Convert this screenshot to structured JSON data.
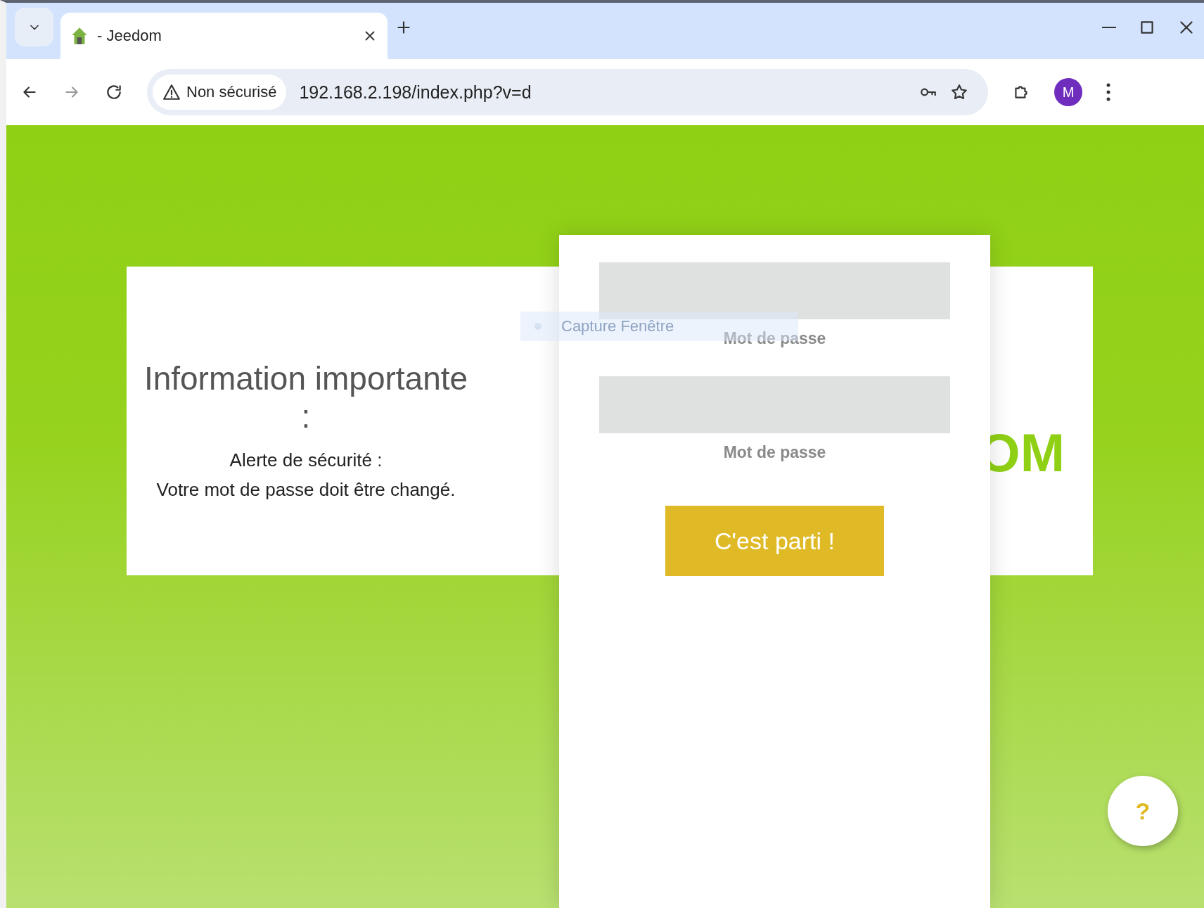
{
  "browser": {
    "tab": {
      "title": "- Jeedom",
      "selected": true
    },
    "security": "Non sécurisé",
    "url": "192.168.2.198/index.php?v=d",
    "profile_initial": "M"
  },
  "info_card": {
    "title_lines": [
      "Information importante",
      ":"
    ],
    "message_lines": [
      "Alerte de sécurité :",
      "Votre mot de passe doit être changé."
    ],
    "logo_fragment": "OM"
  },
  "overlay_tooltip": "Capture Fenêtre",
  "form": {
    "fields": [
      {
        "label": "Mot de passe"
      },
      {
        "label": "Mot de passe"
      }
    ],
    "submit": "C'est parti !"
  },
  "help_button": "?"
}
